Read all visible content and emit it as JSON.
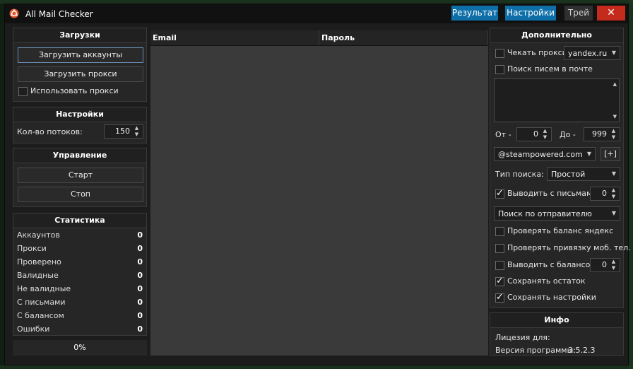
{
  "window": {
    "title": "All Mail Checker"
  },
  "titlebar": {
    "result": "Результат",
    "settings": "Настройки",
    "tray": "Трей",
    "close": "✕"
  },
  "downloads": {
    "title": "Загрузки",
    "load_accounts": "Загрузить аккаунты",
    "load_proxies": "Загрузить прокси",
    "use_proxies": "Использовать прокси"
  },
  "settings": {
    "title": "Настройки",
    "threads_label": "Кол-во потоков:",
    "threads_value": "150"
  },
  "control": {
    "title": "Управление",
    "start": "Старт",
    "stop": "Стоп"
  },
  "stats": {
    "title": "Статистика",
    "rows": [
      {
        "label": "Аккаунтов",
        "value": "0"
      },
      {
        "label": "Прокси",
        "value": "0"
      },
      {
        "label": "Проверено",
        "value": "0"
      },
      {
        "label": "Валидные",
        "value": "0"
      },
      {
        "label": "Не валидные",
        "value": "0"
      },
      {
        "label": "С письмами",
        "value": "0"
      },
      {
        "label": "С балансом",
        "value": "0"
      },
      {
        "label": "Ошибки",
        "value": "0"
      }
    ],
    "progress": "0%"
  },
  "grid": {
    "columns": [
      "Email",
      "Пароль"
    ]
  },
  "extra": {
    "title": "Дополнительно",
    "check_proxies": "Чекать прокси",
    "proxy_site": "yandex.ru",
    "search_mail": "Поиск писем в почте",
    "from_label": "От -",
    "from_value": "0",
    "to_label": "До -",
    "to_value": "999",
    "domain": "@steampowered.com",
    "add_button": "[+]",
    "search_type_label": "Тип поиска:",
    "search_type_value": "Простой",
    "with_letters": "Выводить с письмами",
    "with_letters_value": "0",
    "sender_search": "Поиск по отправителю",
    "check_yandex_balance": "Проверять баланс яндекс",
    "check_phone": "Проверять привязку моб. тел.",
    "with_balance": "Выводить с балансом",
    "with_balance_value": "0",
    "save_rest": "Сохранять остаток",
    "save_settings": "Сохранять настройки"
  },
  "info": {
    "title": "Инфо",
    "license_label": "Лицезия для:",
    "version_label": "Версия программы:",
    "version_value": "3.5.2.3"
  }
}
